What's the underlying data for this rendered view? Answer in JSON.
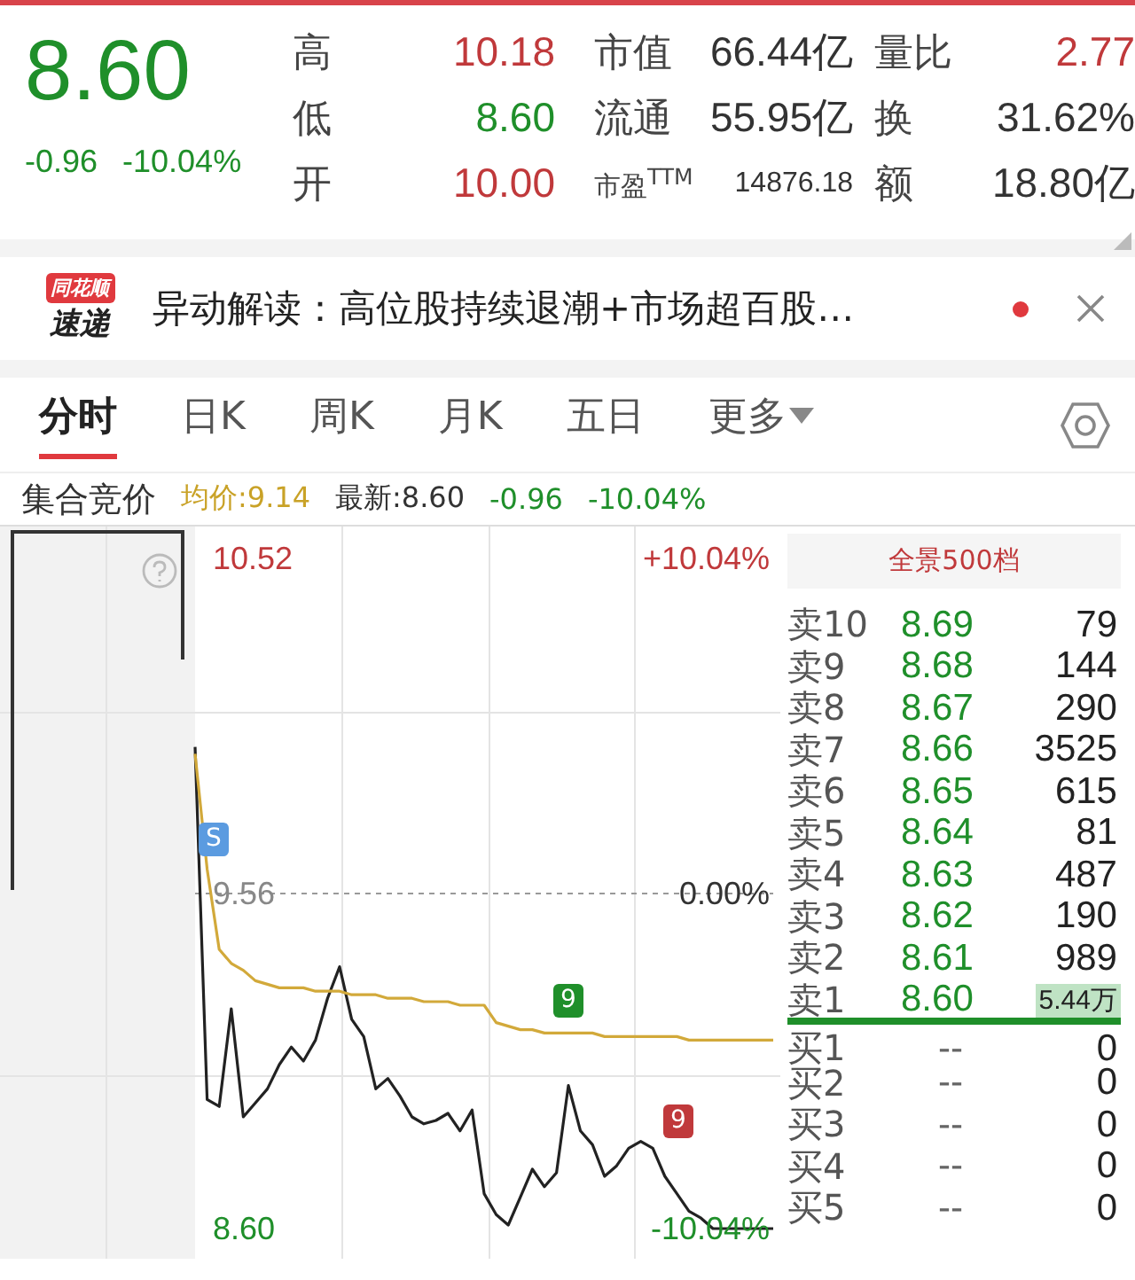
{
  "quote": {
    "price": "8.60",
    "change": "-0.96",
    "change_pct": "-10.04%",
    "color": "#1f8f2a",
    "stats": [
      [
        {
          "label": "高",
          "value": "10.18",
          "color": "#c0393b",
          "kind": "normal"
        },
        {
          "label": "市值",
          "value": "66.44亿",
          "color": "#333333",
          "kind": "normal"
        },
        {
          "label": "量比",
          "value": "2.77",
          "color": "#c0393b",
          "kind": "normal"
        }
      ],
      [
        {
          "label": "低",
          "value": "8.60",
          "color": "#1f8f2a",
          "kind": "normal"
        },
        {
          "label": "流通",
          "value": "55.95亿",
          "color": "#333333",
          "kind": "normal"
        },
        {
          "label": "换",
          "value": "31.62%",
          "color": "#333333",
          "kind": "normal"
        }
      ],
      [
        {
          "label": "开",
          "value": "10.00",
          "color": "#c0393b",
          "kind": "normal"
        },
        {
          "label": "市盈$^{TTM}$",
          "value": "14876.18",
          "color": "#333333",
          "kind": "compact"
        },
        {
          "label": "额",
          "value": "18.80亿",
          "color": "#333333",
          "kind": "normal"
        }
      ]
    ]
  },
  "news": {
    "logo_top": "同花顺",
    "logo_bottom": "速递",
    "headline": "异动解读：高位股持续退潮+市场超百股…",
    "unread": true
  },
  "tabs": [
    {
      "label": "分时",
      "selected": true,
      "dropdown": false
    },
    {
      "label": "日K",
      "selected": false,
      "dropdown": false
    },
    {
      "label": "周K",
      "selected": false,
      "dropdown": false
    },
    {
      "label": "月K",
      "selected": false,
      "dropdown": false
    },
    {
      "label": "五日",
      "selected": false,
      "dropdown": false
    },
    {
      "label": "更多",
      "selected": false,
      "dropdown": true
    }
  ],
  "info_bar": [
    {
      "text": "集合竞价",
      "color": "#333333"
    },
    {
      "text": "均价:9.14",
      "color": "#c9a227"
    },
    {
      "text": "最新:8.60",
      "color": "#333333"
    },
    {
      "text": "-0.96",
      "color": "#1f8f2a"
    },
    {
      "text": "-10.04%",
      "color": "#1f8f2a"
    }
  ],
  "chart": {
    "right_labels": [
      {
        "text": "+10.04%",
        "color": "#c0393b"
      },
      {
        "text": "0.00%",
        "color": "#333333"
      },
      {
        "text": "-10.04%",
        "color": "#1f8f2a"
      }
    ],
    "markers": [
      {
        "text": "S",
        "color": "#5b9be0"
      },
      {
        "text": "9",
        "color": "#1f8f2a"
      },
      {
        "text": "9",
        "color": "#c0393b"
      }
    ],
    "chart_data": {
      "type": "line",
      "ylim": [
        8.6,
        10.52
      ],
      "yticks": [
        {
          "value": 10.52,
          "label": "10.52"
        },
        {
          "value": 9.56,
          "label": "9.56"
        },
        {
          "value": 8.6,
          "label": "8.60"
        }
      ],
      "series": [
        {
          "color": "#222222",
          "values": [
            9.98,
            8.97,
            8.95,
            9.23,
            8.92,
            8.96,
            9.0,
            9.07,
            9.12,
            9.08,
            9.14,
            9.26,
            9.35,
            9.2,
            9.15,
            9.0,
            9.03,
            8.98,
            8.92,
            8.9,
            8.91,
            8.93,
            8.88,
            8.94,
            8.7,
            8.64,
            8.61,
            8.69,
            8.77,
            8.72,
            8.76,
            9.01,
            8.88,
            8.84,
            8.75,
            8.78,
            8.83,
            8.85,
            8.83,
            8.75,
            8.7,
            8.65,
            8.63,
            8.6,
            8.6,
            8.6,
            8.6,
            8.6,
            8.6
          ]
        },
        {
          "color": "#999999",
          "line_style": "dashed",
          "values": [
            9.56,
            9.56,
            9.56,
            9.56,
            9.56,
            9.56,
            9.56,
            9.56,
            9.56,
            9.56,
            9.56,
            9.56,
            9.56,
            9.56,
            9.56,
            9.56,
            9.56,
            9.56,
            9.56,
            9.56,
            9.56,
            9.56,
            9.56,
            9.56,
            9.56,
            9.56,
            9.56,
            9.56,
            9.56,
            9.56,
            9.56,
            9.56,
            9.56,
            9.56,
            9.56,
            9.56,
            9.56,
            9.56,
            9.56,
            9.56,
            9.56,
            9.56,
            9.56,
            9.56,
            9.56,
            9.56,
            9.56,
            9.56,
            9.56
          ]
        },
        {
          "color": "#d2a93a",
          "values": [
            9.96,
            9.63,
            9.4,
            9.36,
            9.34,
            9.31,
            9.3,
            9.29,
            9.29,
            9.29,
            9.28,
            9.28,
            9.28,
            9.27,
            9.27,
            9.27,
            9.26,
            9.26,
            9.26,
            9.25,
            9.25,
            9.25,
            9.24,
            9.24,
            9.24,
            9.19,
            9.18,
            9.17,
            9.17,
            9.16,
            9.16,
            9.16,
            9.16,
            9.16,
            9.15,
            9.15,
            9.15,
            9.15,
            9.15,
            9.15,
            9.15,
            9.14,
            9.14,
            9.14,
            9.14,
            9.14,
            9.14,
            9.14,
            9.14
          ]
        }
      ]
    }
  },
  "order_book": {
    "title": "全景500档",
    "rows": [
      {
        "label": "卖10",
        "price": "8.69",
        "volume": "79",
        "kind": "sell",
        "highlighted": false
      },
      {
        "label": "卖9",
        "price": "8.68",
        "volume": "144",
        "kind": "sell",
        "highlighted": false
      },
      {
        "label": "卖8",
        "price": "8.67",
        "volume": "290",
        "kind": "sell",
        "highlighted": false
      },
      {
        "label": "卖7",
        "price": "8.66",
        "volume": "3525",
        "kind": "sell",
        "highlighted": false
      },
      {
        "label": "卖6",
        "price": "8.65",
        "volume": "615",
        "kind": "sell",
        "highlighted": false
      },
      {
        "label": "卖5",
        "price": "8.64",
        "volume": "81",
        "kind": "sell",
        "highlighted": false
      },
      {
        "label": "卖4",
        "price": "8.63",
        "volume": "487",
        "kind": "sell",
        "highlighted": false
      },
      {
        "label": "卖3",
        "price": "8.62",
        "volume": "190",
        "kind": "sell",
        "highlighted": false
      },
      {
        "label": "卖2",
        "price": "8.61",
        "volume": "989",
        "kind": "sell",
        "highlighted": false
      },
      {
        "label": "卖1",
        "price": "8.60",
        "volume": "5.44万",
        "kind": "sell",
        "highlighted": true
      },
      {
        "label": "买1",
        "price": "--",
        "volume": "0",
        "kind": "buy",
        "highlighted": false
      },
      {
        "label": "买2",
        "price": "--",
        "volume": "0",
        "kind": "buy",
        "highlighted": false
      },
      {
        "label": "买3",
        "price": "--",
        "volume": "0",
        "kind": "buy",
        "highlighted": false
      },
      {
        "label": "买4",
        "price": "--",
        "volume": "0",
        "kind": "buy",
        "highlighted": false
      },
      {
        "label": "买5",
        "price": "--",
        "volume": "0",
        "kind": "buy",
        "highlighted": false
      }
    ]
  }
}
